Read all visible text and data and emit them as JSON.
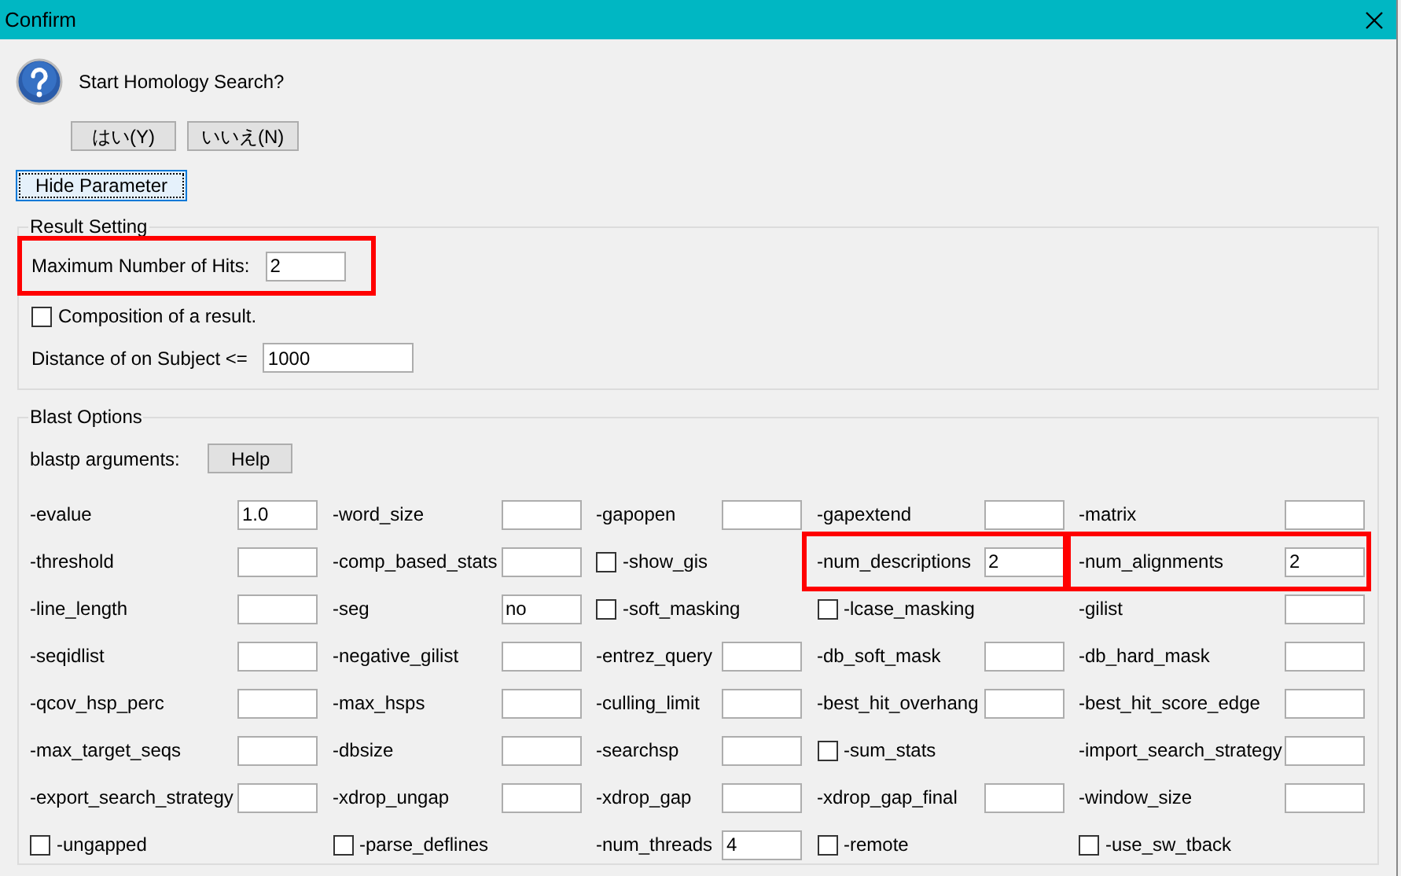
{
  "window": {
    "title": "Confirm"
  },
  "message": "Start Homology Search?",
  "dialog_buttons": [
    {
      "label": "はい(Y)"
    },
    {
      "label": "いいえ(N)"
    }
  ],
  "toggle_button": {
    "label": "Hide Parameter",
    "focused": true
  },
  "result_setting": {
    "title": "Result Setting",
    "max_hits": {
      "label": "Maximum Number of Hits:",
      "value": "2",
      "highlighted": true
    },
    "composition": {
      "label": "Composition of a result.",
      "checked": false
    },
    "distance": {
      "label": "Distance of on Subject <=",
      "value": "1000"
    }
  },
  "blast_options": {
    "title": "Blast Options",
    "arguments_label": "blastp arguments:",
    "help_button": "Help",
    "rows": [
      [
        {
          "kind": "field",
          "label": "-evalue",
          "value": "1.0"
        },
        {
          "kind": "field",
          "label": "-word_size"
        },
        {
          "kind": "field",
          "label": "-gapopen"
        },
        {
          "kind": "field",
          "label": "-gapextend"
        },
        {
          "kind": "field",
          "label": "-matrix"
        }
      ],
      [
        {
          "kind": "field",
          "label": "-threshold"
        },
        {
          "kind": "field",
          "label": "-comp_based_stats"
        },
        {
          "kind": "checkbox",
          "label": "-show_gis",
          "checked": false
        },
        {
          "kind": "field",
          "label": "-num_descriptions",
          "value": "2",
          "highlighted": true
        },
        {
          "kind": "field",
          "label": "-num_alignments",
          "value": "2",
          "highlighted": true
        }
      ],
      [
        {
          "kind": "field",
          "label": "-line_length"
        },
        {
          "kind": "field",
          "label": "-seg",
          "value": "no"
        },
        {
          "kind": "checkbox",
          "label": "-soft_masking",
          "checked": false
        },
        {
          "kind": "checkbox",
          "label": "-lcase_masking",
          "checked": false
        },
        {
          "kind": "field",
          "label": "-gilist"
        }
      ],
      [
        {
          "kind": "field",
          "label": "-seqidlist"
        },
        {
          "kind": "field",
          "label": "-negative_gilist"
        },
        {
          "kind": "field",
          "label": "-entrez_query"
        },
        {
          "kind": "field",
          "label": "-db_soft_mask"
        },
        {
          "kind": "field",
          "label": "-db_hard_mask"
        }
      ],
      [
        {
          "kind": "field",
          "label": "-qcov_hsp_perc"
        },
        {
          "kind": "field",
          "label": "-max_hsps"
        },
        {
          "kind": "field",
          "label": "-culling_limit"
        },
        {
          "kind": "field",
          "label": "-best_hit_overhang"
        },
        {
          "kind": "field",
          "label": "-best_hit_score_edge"
        }
      ],
      [
        {
          "kind": "field",
          "label": "-max_target_seqs"
        },
        {
          "kind": "field",
          "label": "-dbsize"
        },
        {
          "kind": "field",
          "label": "-searchsp"
        },
        {
          "kind": "checkbox",
          "label": "-sum_stats",
          "checked": false
        },
        {
          "kind": "field",
          "label": "-import_search_strategy"
        }
      ],
      [
        {
          "kind": "field",
          "label": "-export_search_strategy"
        },
        {
          "kind": "field",
          "label": "-xdrop_ungap"
        },
        {
          "kind": "field",
          "label": "-xdrop_gap"
        },
        {
          "kind": "field",
          "label": "-xdrop_gap_final"
        },
        {
          "kind": "field",
          "label": "-window_size"
        }
      ],
      [
        {
          "kind": "checkbox",
          "label": "-ungapped",
          "checked": false
        },
        {
          "kind": "checkbox",
          "label": "-parse_deflines",
          "checked": false
        },
        {
          "kind": "field",
          "label": "-num_threads",
          "value": "4"
        },
        {
          "kind": "checkbox",
          "label": "-remote",
          "checked": false
        },
        {
          "kind": "checkbox",
          "label": "-use_sw_tback",
          "checked": false
        }
      ]
    ]
  }
}
